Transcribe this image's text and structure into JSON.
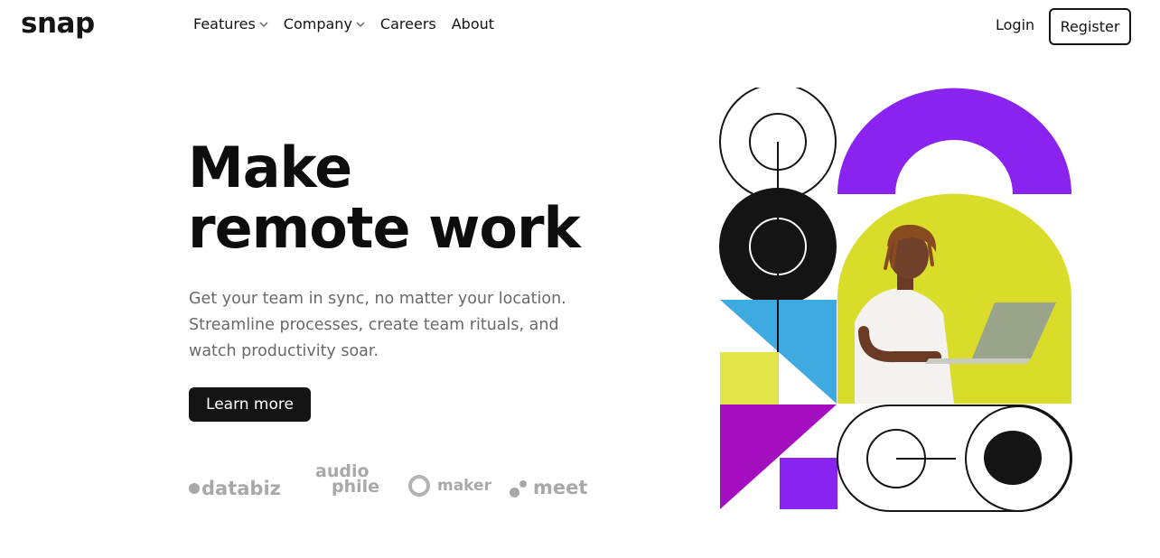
{
  "brand": {
    "logo": "snap"
  },
  "nav": {
    "items": [
      {
        "label": "Features",
        "has_dropdown": true
      },
      {
        "label": "Company",
        "has_dropdown": true
      },
      {
        "label": "Careers",
        "has_dropdown": false
      },
      {
        "label": "About",
        "has_dropdown": false
      }
    ],
    "login_label": "Login",
    "register_label": "Register"
  },
  "hero": {
    "title_line1": "Make",
    "title_line2": "remote work",
    "subtitle": "Get your team in sync, no matter your location. Streamline processes, create team rituals, and watch productivity soar.",
    "cta_label": "Learn more"
  },
  "clients": {
    "databiz": "databiz",
    "audiophile_line1": "audio",
    "audiophile_line2": "phile",
    "maker": "maker",
    "meet": "meet"
  },
  "colors": {
    "ink": "#141414",
    "muted_text": "#696969",
    "logo_gray": "#a8a8a8",
    "purple": "#8a22f0",
    "magenta": "#a30fbf",
    "sky": "#3eaadf",
    "yellow": "#e3e34a",
    "photo_bg": "#d9dd2a"
  },
  "icons": [
    "chevron-down-icon",
    "databiz-logo",
    "audiophile-logo",
    "maker-logo",
    "meet-logo"
  ]
}
